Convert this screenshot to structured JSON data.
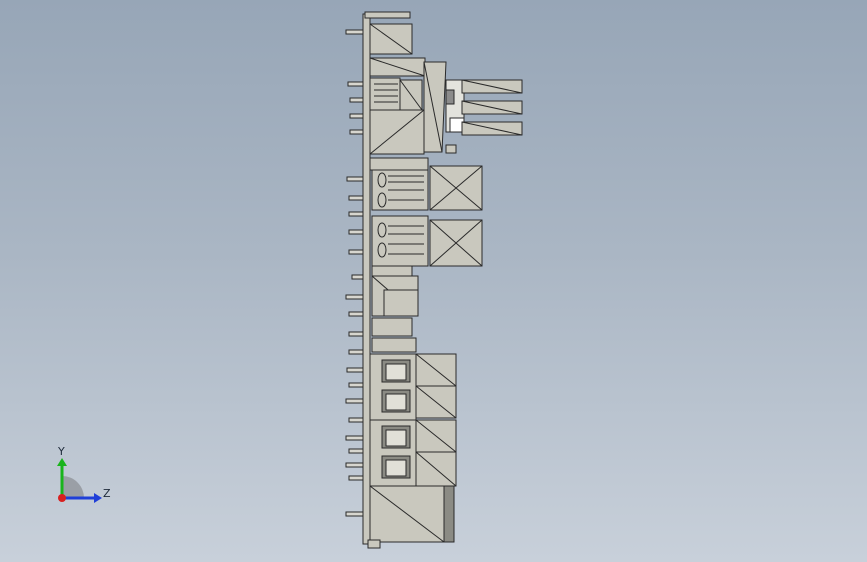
{
  "viewport": {
    "background_top": "#97a6b7",
    "background_bottom": "#c8d0da",
    "model_fill": "#c9c8be",
    "model_stroke": "#2a2a2a"
  },
  "triad": {
    "x_axis_label": "Z",
    "y_axis_label": "Y",
    "x_color": "#1f3fd8",
    "y_color": "#19b41c",
    "origin_color": "#d8201f"
  }
}
